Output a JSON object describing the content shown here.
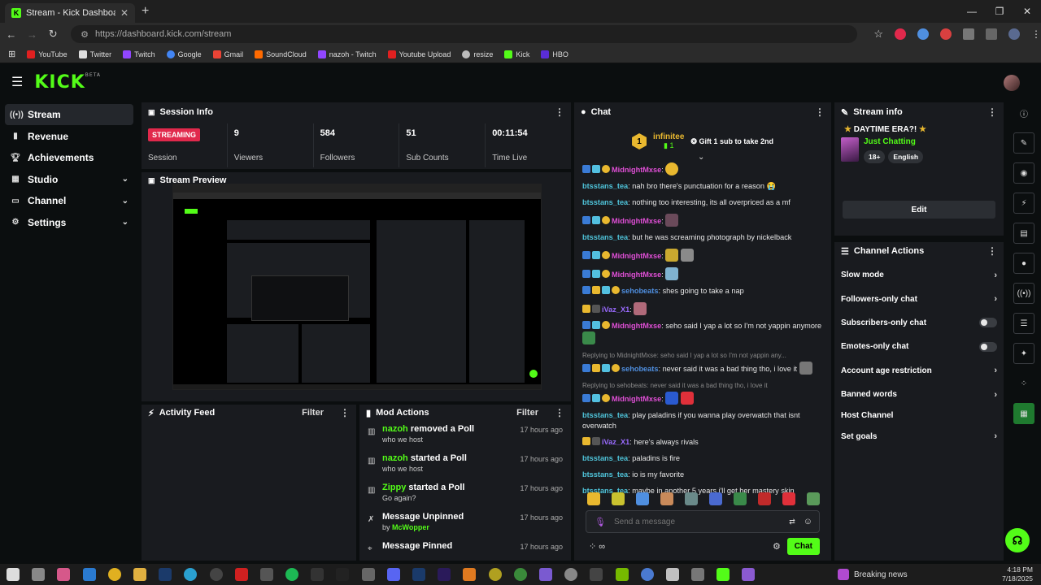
{
  "browser": {
    "tab_title": "Stream - Kick Dashboard",
    "url": "https://dashboard.kick.com/stream",
    "bookmarks": [
      "YouTube",
      "Twitter",
      "Twitch",
      "Google",
      "Gmail",
      "SoundCloud",
      "nazoh - Twitch",
      "Youtube Upload",
      "resize",
      "Kick",
      "HBO"
    ]
  },
  "app": {
    "logo": "KICK",
    "logo_badge": "BETA"
  },
  "sidebar": [
    {
      "label": "Stream",
      "icon": "broadcast-icon",
      "active": true
    },
    {
      "label": "Revenue",
      "icon": "revenue-icon"
    },
    {
      "label": "Achievements",
      "icon": "trophy-icon"
    },
    {
      "label": "Studio",
      "icon": "grid-icon",
      "expandable": true
    },
    {
      "label": "Channel",
      "icon": "channel-icon",
      "expandable": true
    },
    {
      "label": "Settings",
      "icon": "gear-icon",
      "expandable": true
    }
  ],
  "session": {
    "title": "Session Info",
    "status": "STREAMING",
    "status_label": "Session",
    "viewers": "9",
    "viewers_label": "Viewers",
    "followers": "584",
    "followers_label": "Followers",
    "subs": "51",
    "subs_label": "Sub Counts",
    "time": "00:11:54",
    "time_label": "Time Live"
  },
  "preview": {
    "title": "Stream Preview"
  },
  "activity": {
    "title": "Activity Feed",
    "filter": "Filter"
  },
  "mod": {
    "title": "Mod Actions",
    "filter": "Filter",
    "items": [
      {
        "user": "nazoh",
        "action": " removed a Poll",
        "detail": "who we host",
        "time": "17 hours ago",
        "icon": "poll-icon"
      },
      {
        "user": "nazoh",
        "action": " started a Poll",
        "detail": "who we host",
        "time": "17 hours ago",
        "icon": "poll-icon"
      },
      {
        "user": "Zippy",
        "action": " started a Poll",
        "detail": "Go again?",
        "time": "17 hours ago",
        "icon": "poll-icon"
      },
      {
        "user": "",
        "action": "Message Unpinned",
        "detail_prefix": "by ",
        "detail_user": "McWopper",
        "time": "17 hours ago",
        "icon": "unpin-icon"
      },
      {
        "user": "",
        "action": "Message Pinned",
        "detail": "",
        "time": "17 hours ago",
        "icon": "pin-icon"
      }
    ]
  },
  "chat": {
    "title": "Chat",
    "pinned_user": "infinitee",
    "pinned_count": "1",
    "pinned_text": "Gift 1 sub to take 2nd",
    "messages": [
      {
        "user": "MidnightMxse",
        "color": "#e04fd6",
        "text": "",
        "badges": 3
      },
      {
        "user": "btsstans_tea",
        "color": "#4fc3d9",
        "text": "nah bro there's punctuation for a reason 😭",
        "badges": 0
      },
      {
        "user": "btsstans_tea",
        "color": "#4fc3d9",
        "text": "nothing too interesting, its all overpriced as a mf",
        "badges": 0
      },
      {
        "user": "MidnightMxse",
        "color": "#e04fd6",
        "text": "",
        "badges": 3
      },
      {
        "user": "btsstans_tea",
        "color": "#4fc3d9",
        "text": "but he was screaming photograph by nickelback",
        "badges": 0
      },
      {
        "user": "MidnightMxse",
        "color": "#e04fd6",
        "text": "",
        "badges": 3
      },
      {
        "user": "MidnightMxse",
        "color": "#e04fd6",
        "text": "",
        "badges": 3
      },
      {
        "user": "sehobeats",
        "color": "#4f8fe0",
        "text": "shes going to take a nap",
        "badges": 4
      },
      {
        "user": "iVaz_X1",
        "color": "#9a6bff",
        "text": "",
        "badges": 2
      },
      {
        "user": "MidnightMxse",
        "color": "#e04fd6",
        "text": "seho said I yap a lot so I'm not yappin anymore",
        "badges": 3
      },
      {
        "reply": "Replying to MidnightMxse: seho said I yap a lot so I'm not yappin any...",
        "user": "sehobeats",
        "color": "#4f8fe0",
        "text": "never said it was a bad thing tho, i love it",
        "badges": 4
      },
      {
        "reply": "Replying to sehobeats: never said it was a bad thing tho, i love it",
        "user": "MidnightMxse",
        "color": "#e04fd6",
        "text": "",
        "badges": 3
      },
      {
        "user": "btsstans_tea",
        "color": "#4fc3d9",
        "text": "play paladins if you wanna play overwatch that isnt overwatch",
        "badges": 0
      },
      {
        "user": "iVaz_X1",
        "color": "#9a6bff",
        "text": "here's always rivals",
        "badges": 2
      },
      {
        "user": "btsstans_tea",
        "color": "#4fc3d9",
        "text": "paladins is fire",
        "badges": 0
      },
      {
        "user": "btsstans_tea",
        "color": "#4fc3d9",
        "text": "io is my favorite",
        "badges": 0
      },
      {
        "user": "btsstans_tea",
        "color": "#4fc3d9",
        "text": "maybe in another 5 years i'll get her mastery skin",
        "badges": 0
      }
    ],
    "input_placeholder": "Send a message",
    "send_label": "Chat"
  },
  "stream_info": {
    "title": "Stream info",
    "stream_title": "DAYTIME ERA?!",
    "category": "Just Chatting",
    "tags": [
      "18+",
      "English"
    ],
    "edit_label": "Edit"
  },
  "channel_actions": {
    "title": "Channel Actions",
    "items": [
      {
        "label": "Slow mode",
        "control": "arrow"
      },
      {
        "label": "Followers-only chat",
        "control": "arrow"
      },
      {
        "label": "Subscribers-only chat",
        "control": "toggle"
      },
      {
        "label": "Emotes-only chat",
        "control": "toggle"
      },
      {
        "label": "Account age restriction",
        "control": "arrow"
      },
      {
        "label": "Banned words",
        "control": "arrow"
      },
      {
        "label": "Host Channel",
        "control": "none"
      },
      {
        "label": "Set goals",
        "control": "arrow"
      }
    ]
  },
  "taskbar": {
    "news": "Breaking news",
    "time": "4:18 PM",
    "date": "7/18/2025"
  },
  "colors": {
    "accent": "#53fc18",
    "live": "#e1294c",
    "panel": "#191b1f",
    "bg": "#0b0e0f"
  }
}
